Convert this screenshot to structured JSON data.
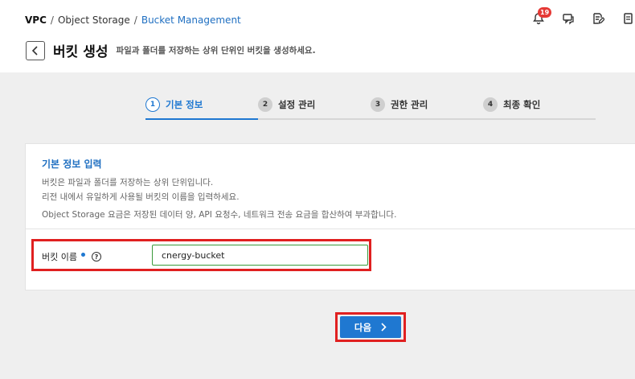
{
  "breadcrumb": {
    "root": "VPC",
    "sep1": "/",
    "item1": "Object Storage",
    "sep2": "/",
    "current": "Bucket Management"
  },
  "header": {
    "notification_count": "19",
    "icons": [
      "bell-icon",
      "chat-icon",
      "edit-note-icon",
      "document-icon"
    ]
  },
  "page": {
    "title": "버킷 생성",
    "description": "파일과 폴더를 저장하는 상위 단위인 버킷을 생성하세요."
  },
  "stepper": {
    "steps": [
      {
        "num": "1",
        "label": "기본 정보",
        "active": true
      },
      {
        "num": "2",
        "label": "설정 관리",
        "active": false
      },
      {
        "num": "3",
        "label": "권한 관리",
        "active": false
      },
      {
        "num": "4",
        "label": "최종 확인",
        "active": false
      }
    ]
  },
  "card": {
    "title": "기본 정보 입력",
    "desc1": "버킷은 파일과 폴더를 저장하는 상위 단위입니다.",
    "desc2": "리전 내에서 유일하게 사용될 버킷의 이름을 입력하세요.",
    "desc3": "Object Storage 요금은 저장된 데이터 양, API 요청수, 네트워크 전송 요금을 합산하여 부과합니다."
  },
  "form": {
    "bucket_name_label": "버킷 이름",
    "help_glyph": "?",
    "bucket_name_value": "cnergy-bucket"
  },
  "actions": {
    "next_label": "다음"
  },
  "colors": {
    "accent": "#1f78d1",
    "highlight": "#e02020",
    "badge": "#e53935",
    "input_border": "#3a9a3a"
  }
}
